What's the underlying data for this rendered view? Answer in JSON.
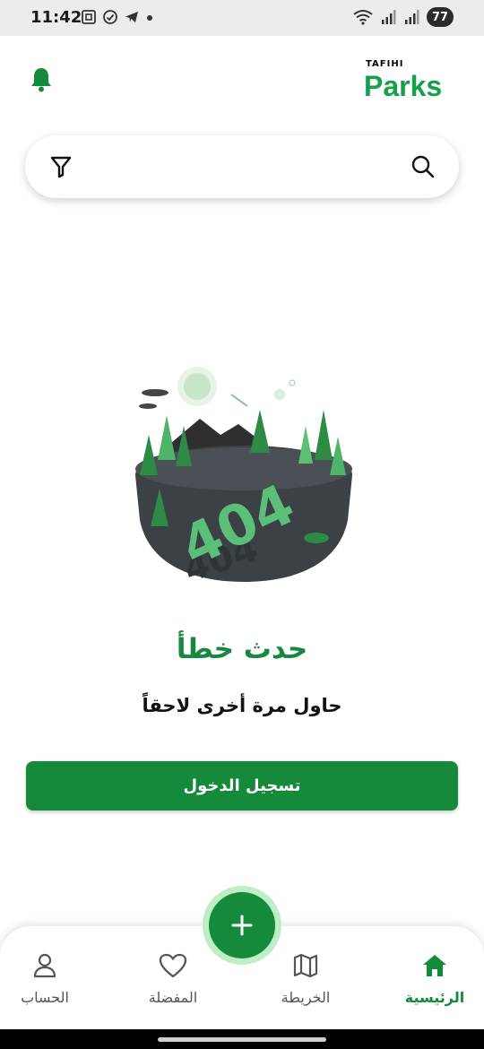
{
  "status_bar": {
    "time": "11:42",
    "battery": "77",
    "icons_left": [
      "screenshot-icon",
      "check-circle-icon",
      "telegram-icon",
      "dot-icon"
    ],
    "icons_right": [
      "wifi-icon",
      "signal-icon",
      "signal-icon",
      "battery-icon"
    ]
  },
  "header": {
    "logo_top": "TAFIHI",
    "logo_main": "Parks",
    "bell_icon": "bell-icon"
  },
  "search": {
    "filter_icon": "filter-icon",
    "search_icon": "search-icon"
  },
  "error": {
    "title": "حدث خطأ",
    "subtitle": "حاول مرة أخرى لاحقاً",
    "illustration_text": "404"
  },
  "login_button": "تسجيل الدخول",
  "fab_icon": "plus-icon",
  "bottom_nav": {
    "items": [
      {
        "label": "الرئيسية",
        "icon": "home-icon",
        "active": true
      },
      {
        "label": "الخريطة",
        "icon": "map-icon",
        "active": false
      },
      {
        "label": "المفضلة",
        "icon": "heart-icon",
        "active": false
      },
      {
        "label": "الحساب",
        "icon": "person-icon",
        "active": false
      }
    ]
  },
  "colors": {
    "primary": "#148a3a",
    "title_green": "#17883e",
    "fab_ring": "#bdeec4",
    "status_bar_bg": "#ececec"
  }
}
